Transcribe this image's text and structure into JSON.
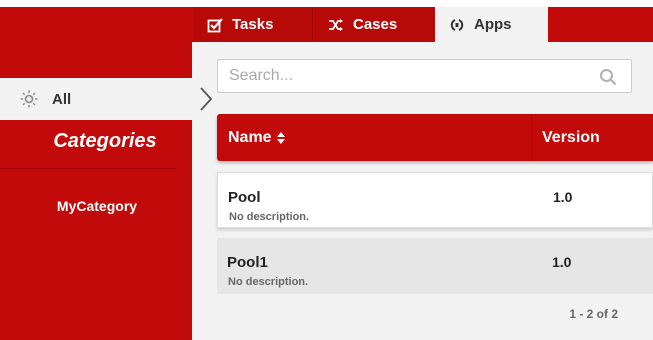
{
  "tabs": [
    {
      "label": "Tasks",
      "icon": "checkbox-icon"
    },
    {
      "label": "Cases",
      "icon": "shuffle-icon"
    },
    {
      "label": "Apps",
      "icon": "apps-icon"
    }
  ],
  "sidebar": {
    "all_label": "All",
    "title": "Categories",
    "categories": [
      {
        "label": "MyCategory"
      }
    ]
  },
  "search": {
    "placeholder": "Search..."
  },
  "table": {
    "headers": {
      "name": "Name",
      "version": "Version"
    },
    "rows": [
      {
        "name": "Pool",
        "description": "No description.",
        "version": "1.0"
      },
      {
        "name": "Pool1",
        "description": "No description.",
        "version": "1.0"
      }
    ]
  },
  "pagination": "1 - 2 of 2",
  "colors": {
    "brand": "#c20a0a",
    "background": "#f2f2f2"
  }
}
